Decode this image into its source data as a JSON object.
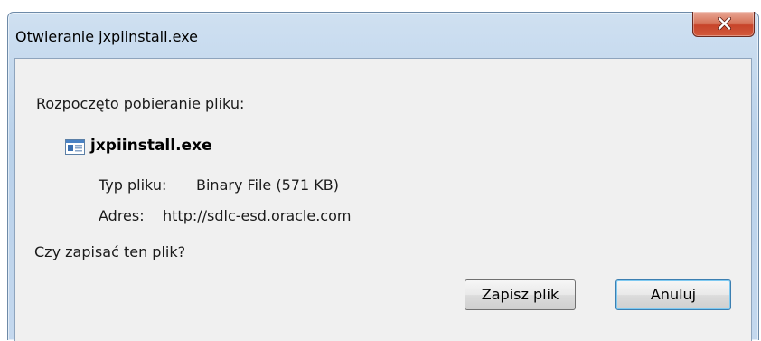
{
  "window": {
    "title": "Otwieranie jxpiinstall.exe",
    "close_icon": "close-x-icon"
  },
  "dialog": {
    "intro": "Rozpoczęto pobieranie pliku:",
    "file_icon": "executable-file-icon",
    "file_name": "jxpiinstall.exe",
    "type_label": "Typ pliku:",
    "type_value": "Binary File (571 KB)",
    "address_label": "Adres:",
    "address_value": "http://sdlc-esd.oracle.com",
    "question": "Czy zapisać ten plik?"
  },
  "buttons": {
    "save_label": "Zapisz plik",
    "cancel_label": "Anuluj"
  },
  "colors": {
    "titlebar": "#b9d1ea",
    "client_background": "#f0f0f0",
    "close_button": "#c7442a",
    "default_button_border": "#3c7fb1"
  }
}
